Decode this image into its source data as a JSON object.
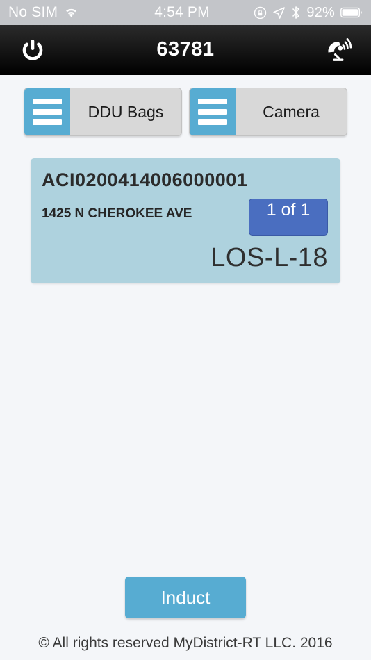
{
  "status_bar": {
    "carrier": "No SIM",
    "wifi_icon": "wifi-icon",
    "time": "4:54 PM",
    "rotation_lock_icon": "rotation-lock-icon",
    "location_icon": "location-arrow-icon",
    "bluetooth_icon": "bluetooth-icon",
    "battery_percent": "92%",
    "battery_icon": "battery-icon"
  },
  "nav_bar": {
    "power_icon": "power-icon",
    "title": "63781",
    "broadcast_icon": "satellite-dish-icon"
  },
  "toolbar": {
    "buttons": [
      {
        "label": "DDU Bags",
        "icon": "hamburger-menu-icon"
      },
      {
        "label": "Camera",
        "icon": "hamburger-menu-icon"
      }
    ]
  },
  "bag_card": {
    "id": "ACI0200414006000001",
    "address": "1425 N CHEROKEE AVE",
    "count_badge": "1 of 1",
    "route_code": "LOS-L-18"
  },
  "actions": {
    "induct_label": "Induct"
  },
  "footer": {
    "copyright": "© All rights reserved MyDistrict-RT LLC. 2016"
  },
  "colors": {
    "accent_blue": "#57acd2",
    "card_blue": "#aed2de",
    "badge_blue": "#4a6ec0",
    "page_background": "#f4f6f9",
    "nav_background": "#141414",
    "status_background": "#c3c5c9"
  }
}
